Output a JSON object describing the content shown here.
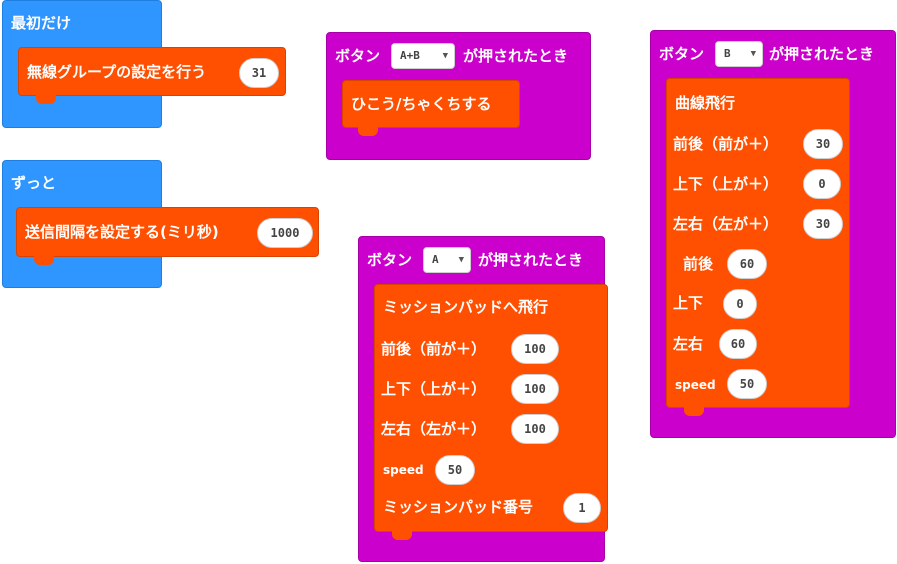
{
  "colors": {
    "event": "#2F95FF",
    "hat": "#CC00CC",
    "command": "#FF4F00",
    "label_text": "#FFFFFF",
    "value_text": "#444444"
  },
  "start_block": {
    "label": "最初だけ",
    "command": {
      "label": "無線グループの設定を行う",
      "value": "31"
    }
  },
  "forever_block": {
    "label": "ずっと",
    "command": {
      "label": "送信間隔を設定する(ミリ秒)",
      "value": "1000"
    }
  },
  "button_ab_block": {
    "prefix": "ボタン",
    "button": "A+B",
    "suffix": "が押されたとき",
    "command": {
      "label": "ひこう/ちゃくちする"
    }
  },
  "button_a_block": {
    "prefix": "ボタン",
    "button": "A",
    "suffix": "が押されたとき",
    "command": {
      "title": "ミッションパッドへ飛行",
      "rows": [
        {
          "label": "前後（前が＋）",
          "value": "100"
        },
        {
          "label": "上下（上が＋）",
          "value": "100"
        },
        {
          "label": "左右（左が＋）",
          "value": "100"
        },
        {
          "label": "speed",
          "value": "50"
        },
        {
          "label": "ミッションパッド番号",
          "value": "1"
        }
      ]
    }
  },
  "button_b_block": {
    "prefix": "ボタン",
    "button": "B",
    "suffix": "が押されたとき",
    "command": {
      "title": "曲線飛行",
      "rows": [
        {
          "label": "前後（前が＋）",
          "value": "30"
        },
        {
          "label": "上下（上が＋）",
          "value": "0"
        },
        {
          "label": "左右（左が＋）",
          "value": "30"
        },
        {
          "label": "前後",
          "value": "60"
        },
        {
          "label": "上下",
          "value": "0"
        },
        {
          "label": "左右",
          "value": "60"
        },
        {
          "label": "speed",
          "value": "50"
        }
      ]
    }
  }
}
